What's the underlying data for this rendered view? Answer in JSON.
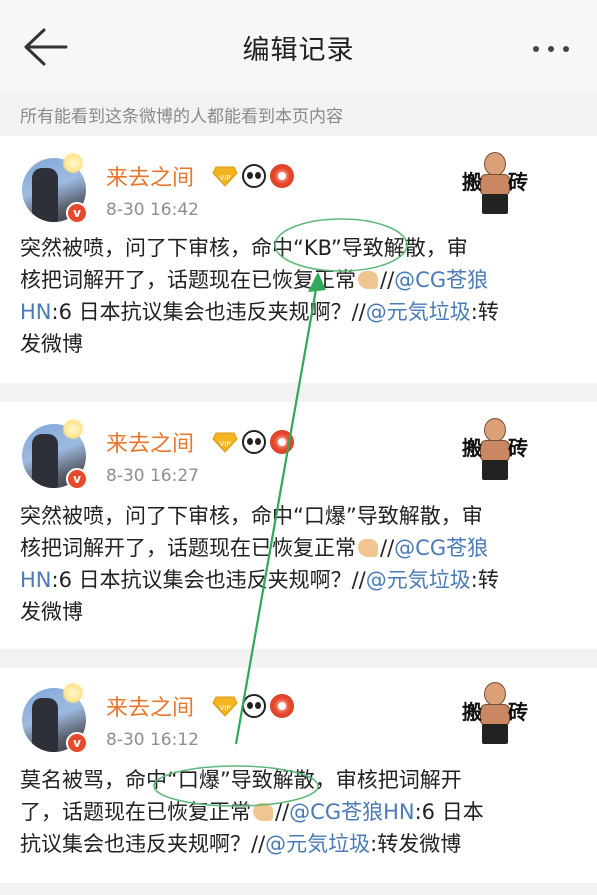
{
  "header": {
    "title": "编辑记录",
    "back_icon": "back-arrow-icon",
    "more_icon": "more-dots-icon"
  },
  "notice": "所有能看到这条微博的人都能看到本页内容",
  "records": [
    {
      "username": "来去之间",
      "time": "8-30 16:42",
      "sticker_chars": [
        "搬",
        "砖"
      ],
      "lines": [
        [
          {
            "t": "突然被喷，问了下审核，命中“KB”导致解散，审"
          }
        ],
        [
          {
            "t": "核把词解开了，话题现在已恢复正常"
          },
          {
            "emoji": "hand"
          },
          {
            "t": "//"
          },
          {
            "m": "@CG苍狼"
          }
        ],
        [
          {
            "m": "HN"
          },
          {
            "t": ":6 日本抗议集会也违反夹规啊？//"
          },
          {
            "m": "@元気垃圾"
          },
          {
            "t": ":转"
          }
        ],
        [
          {
            "t": "发微博"
          }
        ]
      ]
    },
    {
      "username": "来去之间",
      "time": "8-30 16:27",
      "sticker_chars": [
        "搬",
        "砖"
      ],
      "lines": [
        [
          {
            "t": "突然被喷，问了下审核，命中“口爆”导致解散，审"
          }
        ],
        [
          {
            "t": "核把词解开了，话题现在已恢复正常"
          },
          {
            "emoji": "hand"
          },
          {
            "t": "//"
          },
          {
            "m": "@CG苍狼"
          }
        ],
        [
          {
            "m": "HN"
          },
          {
            "t": ":6 日本抗议集会也违反夹规啊？//"
          },
          {
            "m": "@元気垃圾"
          },
          {
            "t": ":转"
          }
        ],
        [
          {
            "t": "发微博"
          }
        ]
      ]
    },
    {
      "username": "来去之间",
      "time": "8-30 16:12",
      "sticker_chars": [
        "搬",
        "砖"
      ],
      "lines": [
        [
          {
            "t": "莫名被骂，命中“口爆”导致解散，审核把词解开"
          }
        ],
        [
          {
            "t": "了，话题现在已恢复正常"
          },
          {
            "emoji": "hand"
          },
          {
            "t": "//"
          },
          {
            "m": "@CG苍狼HN"
          },
          {
            "t": ":6 日本"
          }
        ],
        [
          {
            "t": "抗议集会也违反夹规啊？//"
          },
          {
            "m": "@元気垃圾"
          },
          {
            "t": ":转发微博"
          }
        ]
      ]
    }
  ],
  "colors": {
    "username": "#e8762c",
    "mention": "#4a7bb7",
    "annotation": "#2fa85a",
    "background": "#f2f2f2"
  }
}
